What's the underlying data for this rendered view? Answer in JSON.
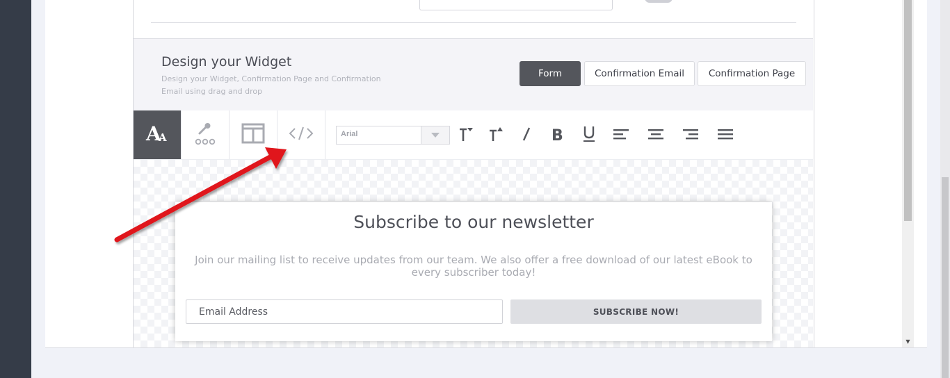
{
  "design": {
    "title": "Design your Widget",
    "subtitle": "Design your Widget, Confirmation Page and Confirmation Email using drag and drop"
  },
  "tabs": [
    {
      "label": "Form",
      "active": true
    },
    {
      "label": "Confirmation Email",
      "active": false
    },
    {
      "label": "Confirmation Page",
      "active": false
    }
  ],
  "toolbar": {
    "tools": [
      "text-style-icon",
      "color-picker-icon",
      "layout-icon",
      "code-icon"
    ],
    "font_value": "Arial",
    "format_buttons": [
      "decrease-font-icon",
      "increase-font-icon",
      "italic-icon",
      "bold-icon",
      "underline-icon",
      "align-left-icon",
      "align-center-icon",
      "align-right-icon",
      "align-justify-icon"
    ]
  },
  "widget": {
    "title": "Subscribe to our newsletter",
    "description": "Join our mailing list to receive updates from our team. We also offer a free download of our latest eBook to every subscriber today!",
    "email_placeholder": "Email Address",
    "button_label": "SUBSCRIBE NOW!"
  },
  "colors": {
    "accent_dark": "#54565c",
    "sidebar": "#353c48",
    "arrow": "#e0161b"
  }
}
